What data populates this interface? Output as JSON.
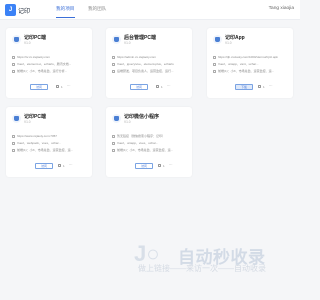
{
  "header": {
    "site_name": "记印",
    "tabs": [
      {
        "label": "我的项目",
        "active": true
      },
      {
        "label": "我的团队",
        "active": false
      }
    ],
    "user_name": "Tang xiaojia"
  },
  "cards": [
    {
      "title": "记印PC端",
      "version": "V1.0",
      "link": "https://tv.xx.xiejiaoty.com",
      "tech": "Vue2、element-ui、echarts、腾讯文档...",
      "members": "前端(1)：小X、市场总监、运行分析...",
      "button": "访问",
      "count": "1"
    },
    {
      "title": "后台管理PC端",
      "version": "V1.0",
      "link": "https://admin.xx.xiejiaoty.com",
      "tech": "Vue2、jquery/vue、element-plus、echarts",
      "members": "后端研发、项目负责人、运营监控、运行...",
      "button": "访问",
      "count": "1"
    },
    {
      "title": "记印App",
      "version": "V1.0",
      "link": "https://tjb.xxxiaoty.com/1000/xlermurbjrct.apk",
      "tech": "Vue2、uniapp、vant、uchar...",
      "members": "前端(1)：小X、市场总监、运营监控、运...",
      "button": "下载",
      "count": "1"
    },
    {
      "title": "记印PC端",
      "version": "V1.0",
      "link": "https://www.xxjiaoty.com:7057",
      "tech": "Vue2、webpack、vuex、uchar...",
      "members": "前端(1)：小X、市场总监、运营监控、运...",
      "button": "访问",
      "count": "1"
    },
    {
      "title": "记印微信小程序",
      "version": "V1.0",
      "link": "暂无链接（微信搜索小程序：记印）",
      "tech": "Vue2、uniapp、vuex、uchar...",
      "members": "前端(1)：小X、市场总监、运营监控、运...",
      "button": "访问",
      "count": "1"
    }
  ],
  "watermark": {
    "title": "自动秒收录",
    "subtitle": "做上链接——来访一次——自动收录"
  }
}
